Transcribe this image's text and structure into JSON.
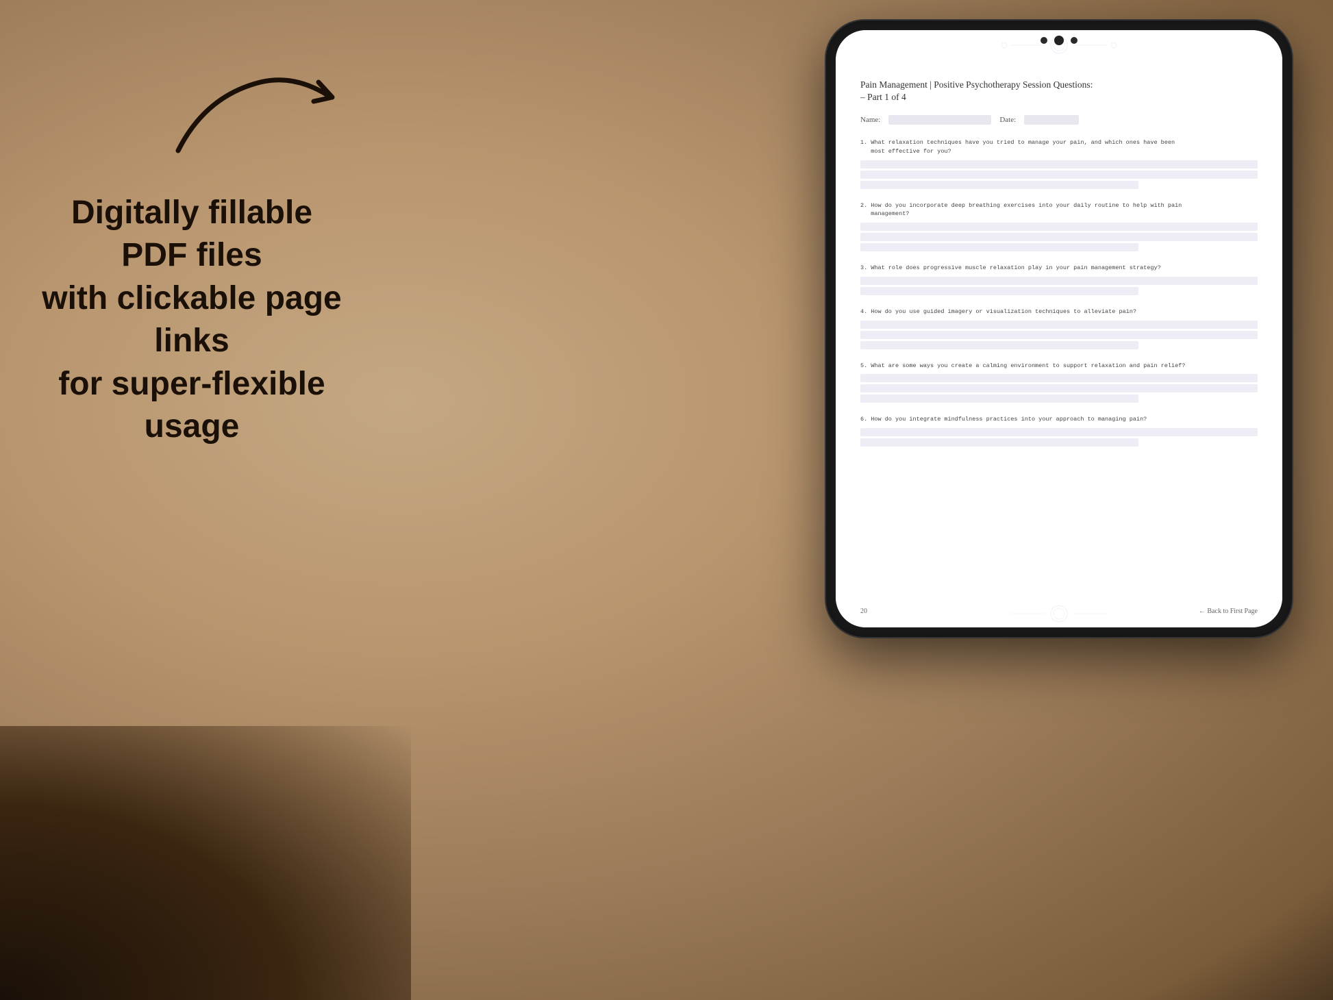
{
  "background": {
    "alt": "Tan/brown background with hands holding tablet"
  },
  "left_text": {
    "line1": "Digitally fillable PDF files",
    "line2": "with clickable page links",
    "line3": "for super-flexible usage"
  },
  "pdf": {
    "title": "Pain Management | Positive Psychotherapy Session Questions:",
    "subtitle": "– Part 1 of 4",
    "name_label": "Name:",
    "date_label": "Date:",
    "questions": [
      {
        "number": "1.",
        "text": "What relaxation techniques have you tried to manage your pain, and which ones have been\nmost effective for you?"
      },
      {
        "number": "2.",
        "text": "How do you incorporate deep breathing exercises into your daily routine to help with pain\nmanagement?"
      },
      {
        "number": "3.",
        "text": "What role does progressive muscle relaxation play in your pain management strategy?"
      },
      {
        "number": "4.",
        "text": "How do you use guided imagery or visualization techniques to alleviate pain?"
      },
      {
        "number": "5.",
        "text": "What are some ways you create a calming environment to support relaxation and pain relief?"
      },
      {
        "number": "6.",
        "text": "How do you integrate mindfulness practices into your approach to managing pain?"
      }
    ],
    "footer": {
      "page_number": "20",
      "back_link": "← Back to First Page"
    }
  }
}
